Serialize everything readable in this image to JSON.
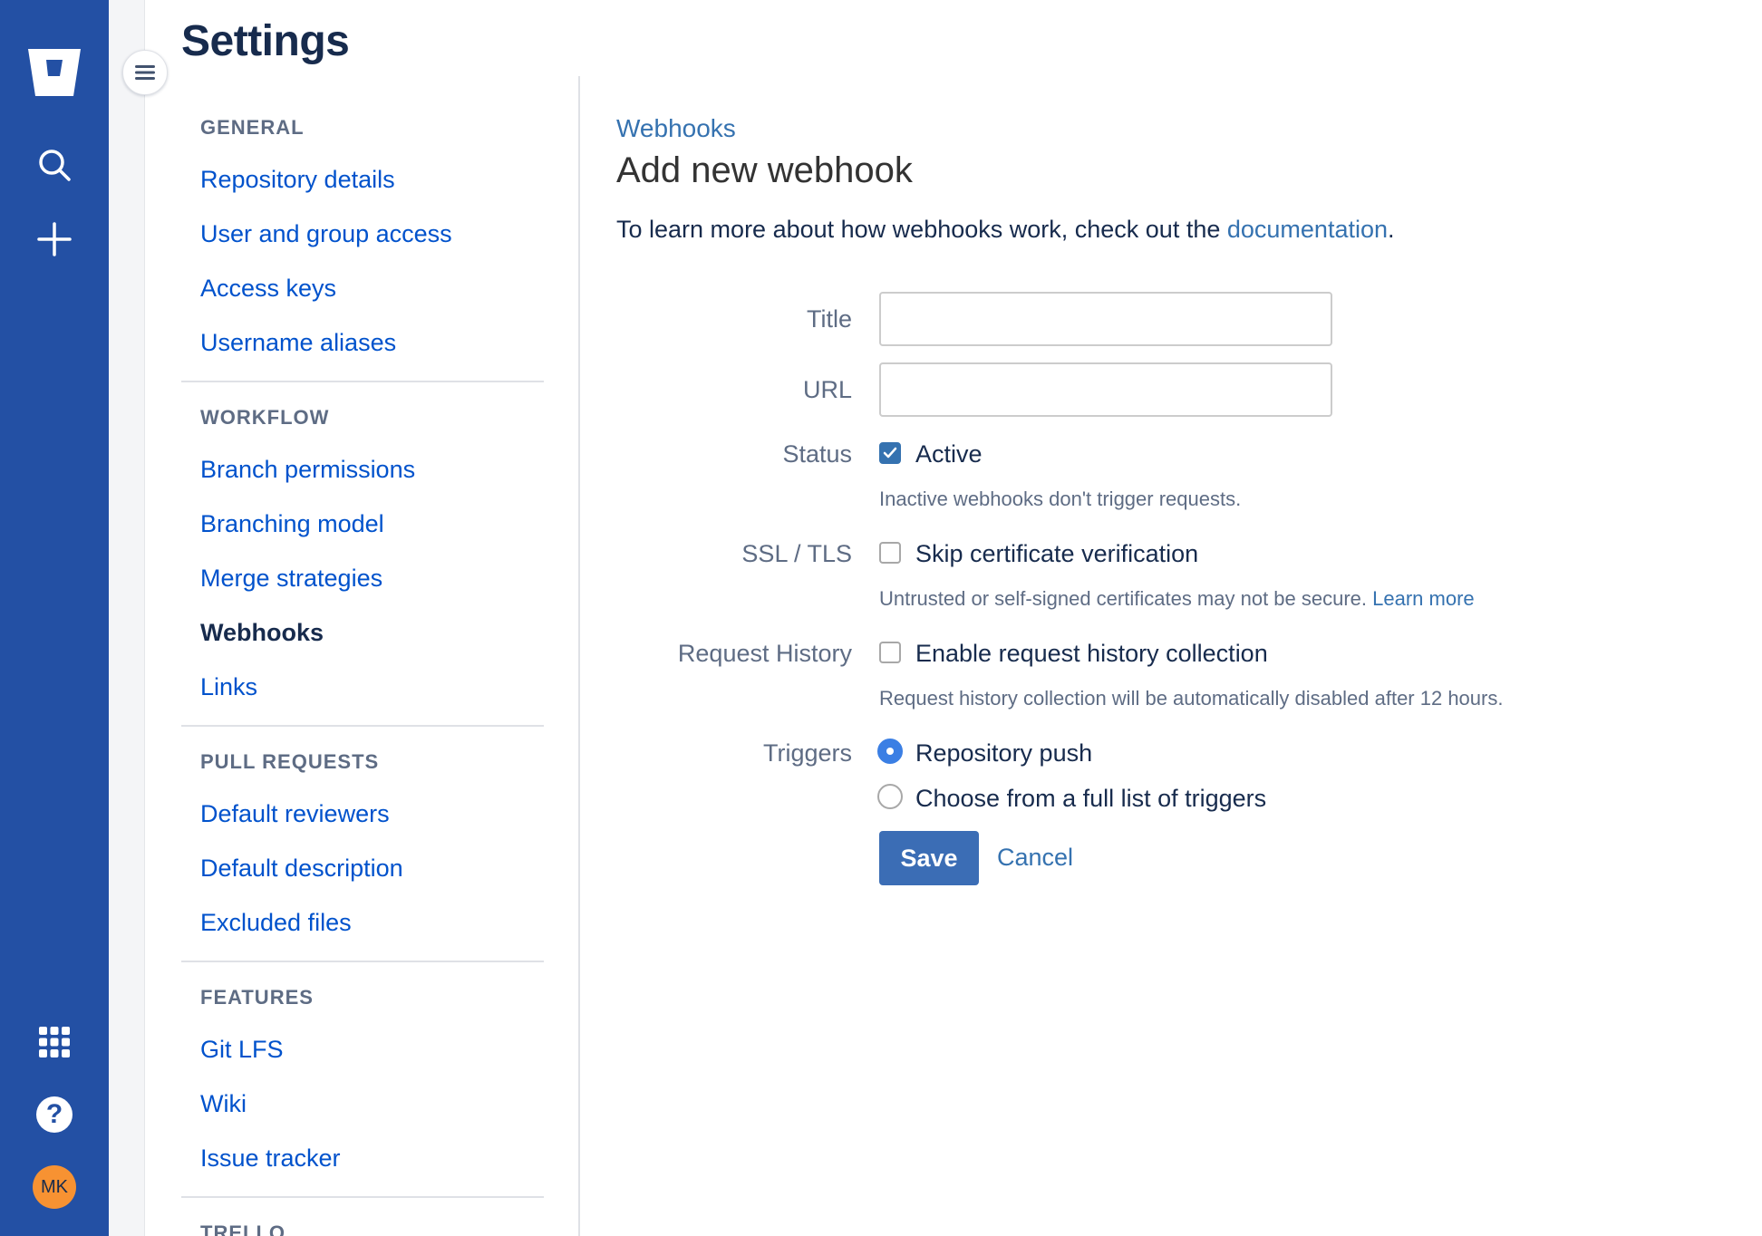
{
  "global_nav": {
    "avatar_initials": "MK",
    "help_glyph": "?",
    "brand_color": "#2350a4",
    "avatar_color": "#f79232",
    "icons": [
      "bitbucket-logo-icon",
      "search-icon",
      "plus-icon",
      "app-switcher-icon",
      "help-icon"
    ]
  },
  "page_title": "Settings",
  "settings_nav": {
    "sections": [
      {
        "heading": "GENERAL",
        "items": [
          "Repository details",
          "User and group access",
          "Access keys",
          "Username aliases"
        ]
      },
      {
        "heading": "WORKFLOW",
        "items": [
          "Branch permissions",
          "Branching model",
          "Merge strategies",
          "Webhooks",
          "Links"
        ]
      },
      {
        "heading": "PULL REQUESTS",
        "items": [
          "Default reviewers",
          "Default description",
          "Excluded files"
        ]
      },
      {
        "heading": "FEATURES",
        "items": [
          "Git LFS",
          "Wiki",
          "Issue tracker"
        ]
      },
      {
        "heading": "TRELLO",
        "items": []
      }
    ],
    "selected_item": "Webhooks"
  },
  "content": {
    "breadcrumb": "Webhooks",
    "heading": "Add new webhook",
    "intro_prefix": "To learn more about how webhooks work, check out the ",
    "intro_link": "documentation",
    "intro_suffix": ".",
    "form": {
      "title_label": "Title",
      "title_value": "",
      "url_label": "URL",
      "url_value": "",
      "status_label": "Status",
      "status_option": "Active",
      "status_checked": true,
      "status_help": "Inactive webhooks don't trigger requests.",
      "ssl_label": "SSL / TLS",
      "ssl_option": "Skip certificate verification",
      "ssl_checked": false,
      "ssl_help": "Untrusted or self-signed certificates may not be secure. ",
      "ssl_help_link": "Learn more",
      "history_label": "Request History",
      "history_option": "Enable request history collection",
      "history_checked": false,
      "history_help": "Request history collection will be automatically disabled after 12 hours.",
      "triggers_label": "Triggers",
      "trigger_options": [
        "Repository push",
        "Choose from a full list of triggers"
      ],
      "selected_trigger": "Repository push"
    },
    "save_label": "Save",
    "cancel_label": "Cancel"
  }
}
